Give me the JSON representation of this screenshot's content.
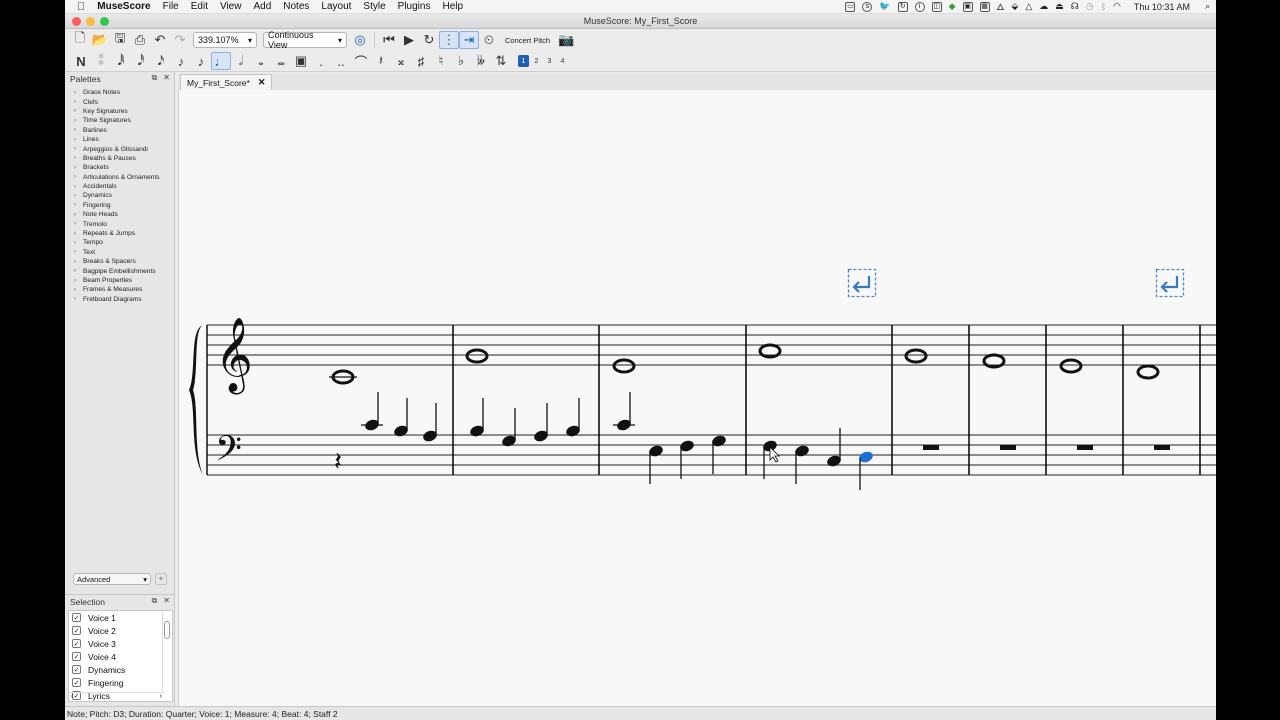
{
  "menubar": {
    "app": "MuseScore",
    "items": [
      "File",
      "Edit",
      "View",
      "Add",
      "Notes",
      "Layout",
      "Style",
      "Plugins",
      "Help"
    ],
    "clock": "Thu 10:31 AM"
  },
  "window": {
    "title": "MuseScore: My_First_Score"
  },
  "toolbar": {
    "zoom": "339.107%",
    "view_mode": "Continuous View",
    "concert_pitch": "Concert Pitch",
    "voices": [
      "1",
      "2",
      "3",
      "4"
    ]
  },
  "palettes": {
    "title": "Palettes",
    "items": [
      "Grace Notes",
      "Clefs",
      "Key Signatures",
      "Time Signatures",
      "Barlines",
      "Lines",
      "Arpeggios & Glissandi",
      "Breaths & Pauses",
      "Brackets",
      "Articulations & Ornaments",
      "Accidentals",
      "Dynamics",
      "Fingering",
      "Note Heads",
      "Tremolo",
      "Repeats & Jumps",
      "Tempo",
      "Text",
      "Breaks & Spacers",
      "Bagpipe Embellishments",
      "Beam Properties",
      "Frames & Measures",
      "Fretboard Diagrams"
    ],
    "workspace": "Advanced"
  },
  "selection": {
    "title": "Selection",
    "items": [
      "Voice 1",
      "Voice 2",
      "Voice 3",
      "Voice 4",
      "Dynamics",
      "Fingering",
      "Lyrics"
    ]
  },
  "tab": {
    "label": "My_First_Score*"
  },
  "status": "Note; Pitch: D3; Duration: Quarter; Voice: 1;  Measure: 4; Beat: 4; Staff 2",
  "colors": {
    "selected_note": "#1f6fd0",
    "line_break": "#4a86c8",
    "accent": "#1f5fb4"
  }
}
